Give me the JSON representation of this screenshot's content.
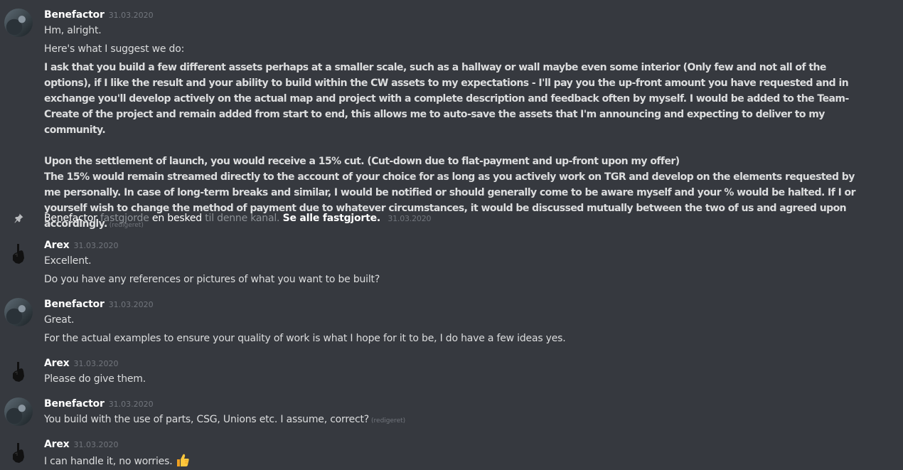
{
  "messages": [
    {
      "author": "Benefactor",
      "timestamp": "31.03.2020",
      "lines": [
        "Hm, alright.",
        "Here's what I suggest we do:"
      ],
      "bold_paragraphs": [
        "I ask that you build a few different assets perhaps at a smaller scale, such as a hallway or wall maybe even some interior (Only few and not all of the options), if I like the result and your ability to build within the CW assets to my expectations - I'll pay you the up-front amount you have requested and in exchange you'll develop actively on the actual map and project with a complete description and feedback often by myself. I would be added to the Team-Create of the project and remain added from start to end, this allows me to auto-save the assets that I'm announcing and expecting to deliver to my community.",
        "Upon the settlement of launch, you would receive a 15% cut. (Cut-down due to flat-payment and up-front upon my offer)",
        "The 15% would remain streamed directly to the account of your choice for as long as you actively work on TGR and develop on the elements requested by me personally. In case of long-term breaks and similar, I would be notified or should generally come to be aware myself and your % would be halted. If I or yourself wish to change the method of payment due to whatever circumstances, it would be discussed mutually between the two of us and agreed upon accordingly."
      ],
      "edited": "(redigeret)"
    },
    {
      "author": "Arex",
      "timestamp": "31.03.2020",
      "lines": [
        "Excellent.",
        "Do you have any references or pictures of what you want to be built?"
      ]
    },
    {
      "author": "Benefactor",
      "timestamp": "31.03.2020",
      "lines": [
        "Great.",
        "For the actual examples to ensure your quality of work is what I hope for it to be, I do have a few ideas yes."
      ]
    },
    {
      "author": "Arex",
      "timestamp": "31.03.2020",
      "lines": [
        "Please do give them."
      ]
    },
    {
      "author": "Benefactor",
      "timestamp": "31.03.2020",
      "lines": [
        "You build with the use of parts, CSG, Unions etc. I assume, correct?"
      ],
      "edited": "(redigeret)"
    },
    {
      "author": "Arex",
      "timestamp": "31.03.2020",
      "lines": [
        "I can handle it, no worries."
      ],
      "emoji": "thumbs-up"
    }
  ],
  "pin_notice": {
    "author": "Benefactor",
    "action": "fastgjorde",
    "object": "en besked",
    "target": "til denne kanal.",
    "link": "Se alle fastgjorte.",
    "timestamp": "31.03.2020"
  },
  "colors": {
    "background": "#36393f",
    "text": "#dcddde",
    "username": "#ffffff",
    "muted": "#72767d"
  }
}
